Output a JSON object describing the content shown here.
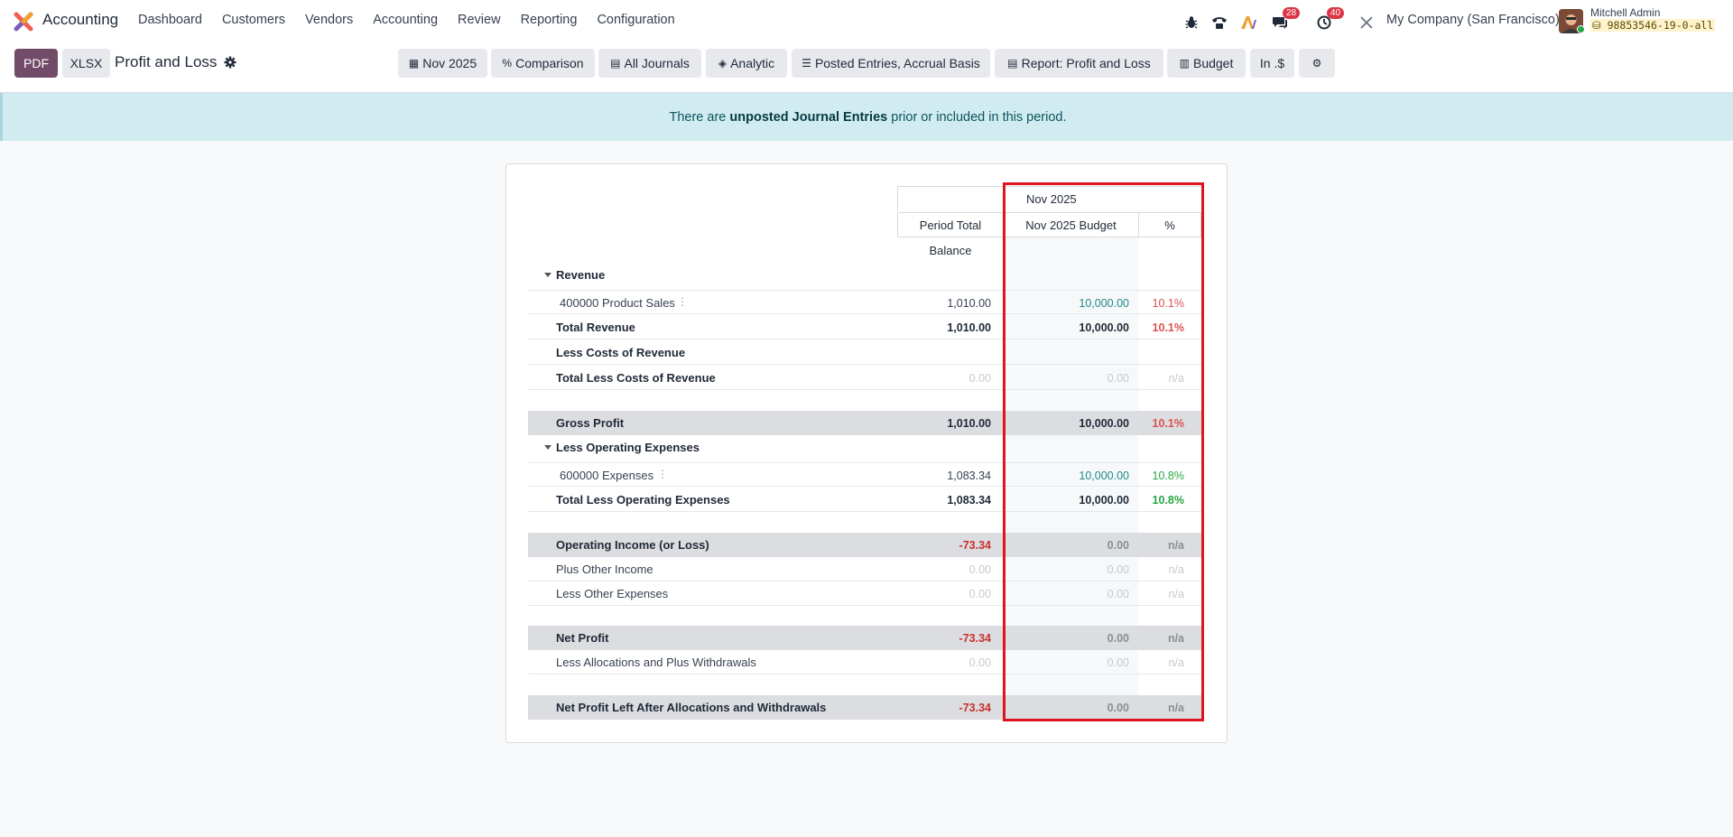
{
  "navbar": {
    "app_name": "Accounting",
    "menu": [
      "Dashboard",
      "Customers",
      "Vendors",
      "Accounting",
      "Review",
      "Reporting",
      "Configuration"
    ],
    "messages_badge": "28",
    "activities_badge": "40",
    "company": "My Company (San Francisco)",
    "user_name": "Mitchell Admin",
    "database": "98853546-19-0-all"
  },
  "control_panel": {
    "pdf_label": "PDF",
    "xlsx_label": "XLSX",
    "title": "Profit and Loss",
    "filters": {
      "date": "Nov 2025",
      "comparison": "Comparison",
      "journals": "All Journals",
      "analytic": "Analytic",
      "entries": "Posted Entries, Accrual Basis",
      "report": "Report: Profit and Loss",
      "budget": "Budget",
      "currency": "In .$"
    }
  },
  "alert": {
    "prefix": "There are ",
    "link": "unposted Journal Entries",
    "suffix": " prior or included in this period."
  },
  "report": {
    "headers": {
      "group": "Nov 2025",
      "period_total": "Period Total",
      "budget": "Nov 2025 Budget",
      "pct": "%",
      "balance": "Balance"
    },
    "rows": [
      {
        "label": "Revenue",
        "balance": "",
        "budget": "",
        "pct": ""
      },
      {
        "label": "400000 Product Sales",
        "balance": "1,010.00",
        "budget": "10,000.00",
        "pct": "10.1%"
      },
      {
        "label": "Total Revenue",
        "balance": "1,010.00",
        "budget": "10,000.00",
        "pct": "10.1%"
      },
      {
        "label": "Less Costs of Revenue",
        "balance": "",
        "budget": "",
        "pct": ""
      },
      {
        "label": "Total Less Costs of Revenue",
        "balance": "0.00",
        "budget": "0.00",
        "pct": "n/a"
      },
      {
        "label": "Gross Profit",
        "balance": "1,010.00",
        "budget": "10,000.00",
        "pct": "10.1%"
      },
      {
        "label": "Less Operating Expenses",
        "balance": "",
        "budget": "",
        "pct": ""
      },
      {
        "label": "600000 Expenses",
        "balance": "1,083.34",
        "budget": "10,000.00",
        "pct": "10.8%"
      },
      {
        "label": "Total Less Operating Expenses",
        "balance": "1,083.34",
        "budget": "10,000.00",
        "pct": "10.8%"
      },
      {
        "label": "Operating Income (or Loss)",
        "balance": "-73.34",
        "budget": "0.00",
        "pct": "n/a"
      },
      {
        "label": "Plus Other Income",
        "balance": "0.00",
        "budget": "0.00",
        "pct": "n/a"
      },
      {
        "label": "Less Other Expenses",
        "balance": "0.00",
        "budget": "0.00",
        "pct": "n/a"
      },
      {
        "label": "Net Profit",
        "balance": "-73.34",
        "budget": "0.00",
        "pct": "n/a"
      },
      {
        "label": "Less Allocations and Plus Withdrawals",
        "balance": "0.00",
        "budget": "0.00",
        "pct": "n/a"
      },
      {
        "label": "Net Profit Left After Allocations and Withdrawals",
        "balance": "-73.34",
        "budget": "0.00",
        "pct": "n/a"
      }
    ]
  },
  "colors": {
    "primary": "#714b67",
    "alert_bg": "#d1ecf1",
    "highlight": "#e0141e",
    "negative": "#c9302c",
    "budget_value": "#1f8a8a",
    "pct_over": "#28a745",
    "pct_under": "#d9534f"
  }
}
